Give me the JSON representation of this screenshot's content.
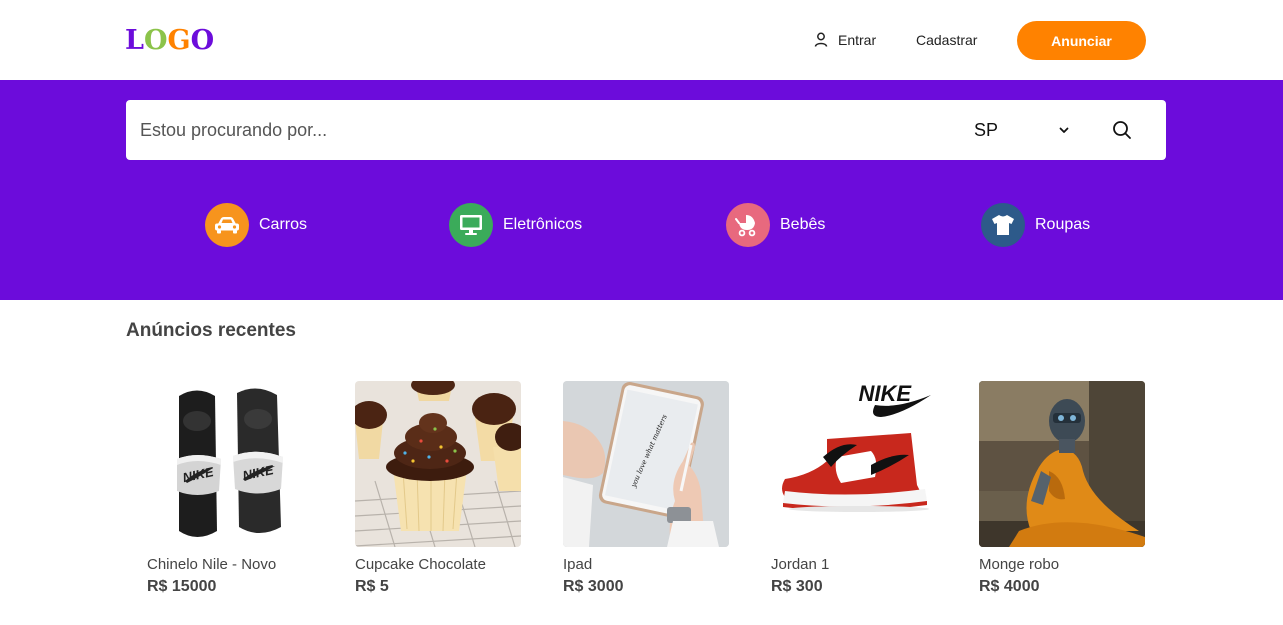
{
  "header": {
    "logo_letters": [
      "L",
      "O",
      "G",
      "O"
    ],
    "logo_colors": [
      "#6c0cdb",
      "#8bc34a",
      "#ff8200",
      "#6c0cdb"
    ],
    "login_label": "Entrar",
    "register_label": "Cadastrar",
    "post_ad_label": "Anunciar",
    "accent_color": "#ff8200"
  },
  "search": {
    "placeholder": "Estou procurando por...",
    "state_value": "SP",
    "brand_color": "#6c0cdb"
  },
  "categories": [
    {
      "label": "Carros",
      "icon": "car-icon",
      "color": "#f7941d"
    },
    {
      "label": "Eletrônicos",
      "icon": "monitor-icon",
      "color": "#3bab5a"
    },
    {
      "label": "Bebês",
      "icon": "stroller-icon",
      "color": "#e8697e"
    },
    {
      "label": "Roupas",
      "icon": "tshirt-icon",
      "color": "#2d5a8a"
    }
  ],
  "recent": {
    "title": "Anúncios recentes",
    "items": [
      {
        "title": "Chinelo Nile - Novo",
        "price": "R$ 15000",
        "image": "slides-image",
        "brand_text": "NIKE"
      },
      {
        "title": "Cupcake Chocolate",
        "price": "R$ 5",
        "image": "cupcake-image"
      },
      {
        "title": "Ipad",
        "price": "R$ 3000",
        "image": "tablet-image",
        "screen_text": "you love what matters"
      },
      {
        "title": "Jordan 1",
        "price": "R$ 300",
        "image": "sneaker-image",
        "brand_text": "NIKE"
      },
      {
        "title": "Monge robo",
        "price": "R$ 4000",
        "image": "robot-monk-image"
      }
    ]
  }
}
